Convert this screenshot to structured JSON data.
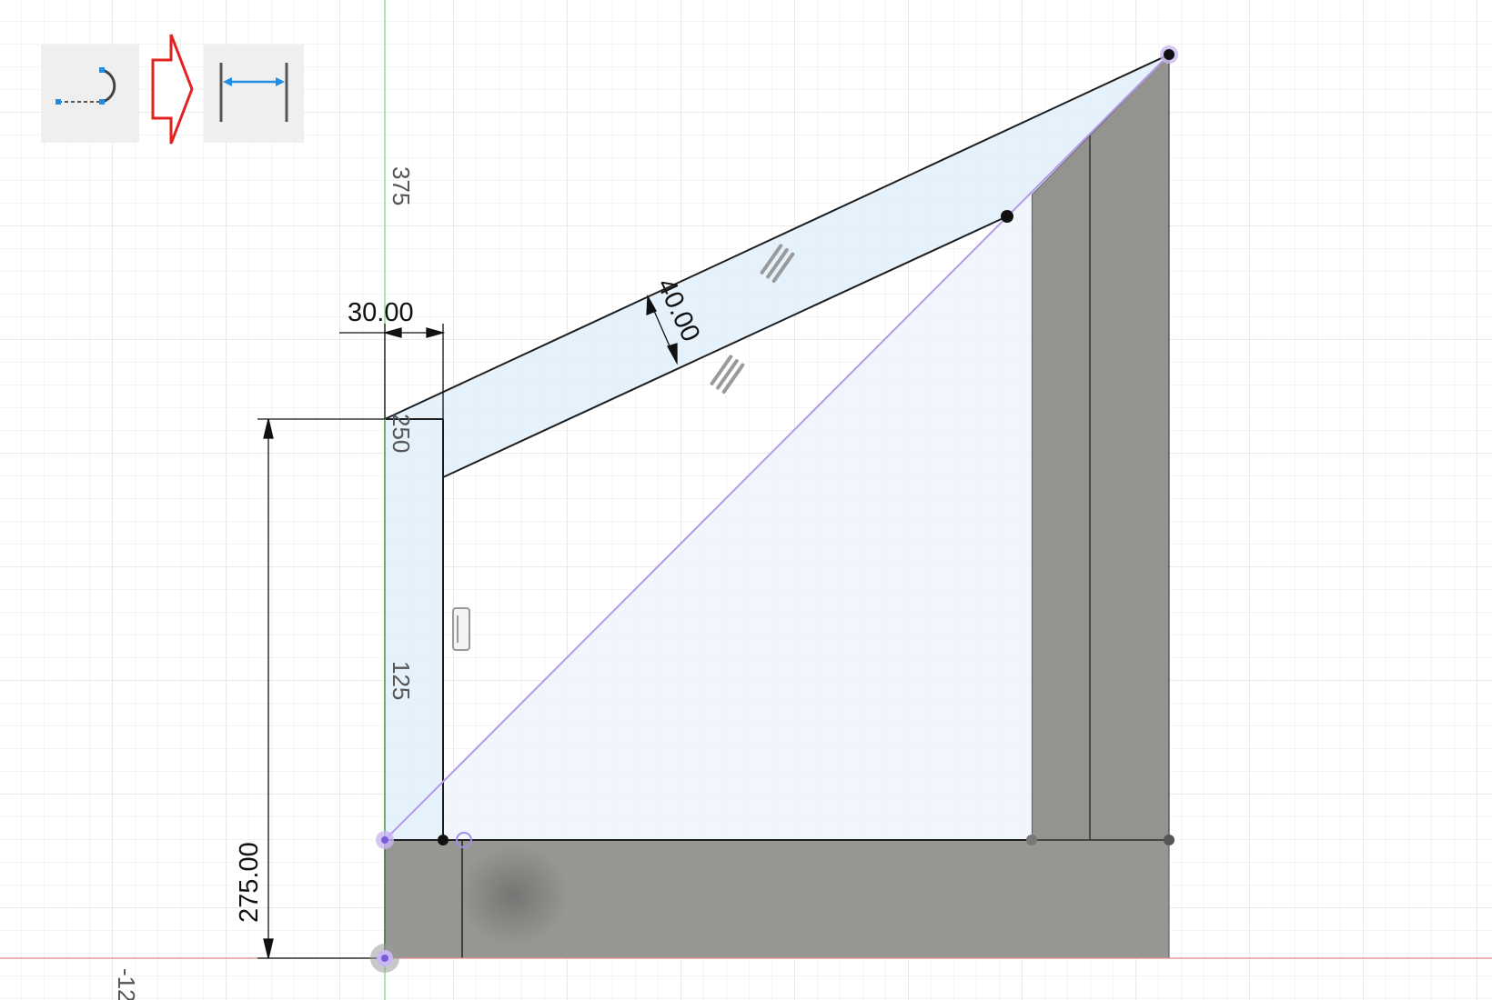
{
  "toolbar": {
    "source_tool_icon": "line-arc-sketch-icon",
    "arrow_icon": "red-arrow-right-icon",
    "target_tool_icon": "sketch-dimension-icon"
  },
  "grid_labels": {
    "top": "375",
    "mid": "250",
    "low": "125",
    "bottom_left": "-12"
  },
  "dimensions": {
    "width_top": "30.00",
    "diagonal_offset": "40.00",
    "height_left": "275.00"
  },
  "colors": {
    "grid_minor": "#e6e6e6",
    "grid_major": "#d4d4d4",
    "y_axis": "#8ee08e",
    "x_axis": "#d98b8b",
    "profile_fill": "#e8f2fc",
    "body_fill": "#919191",
    "construction_line": "#b29ae8",
    "arrow_outline": "#e2221f",
    "dimension_arrow_icon": "#1f8ee6"
  }
}
